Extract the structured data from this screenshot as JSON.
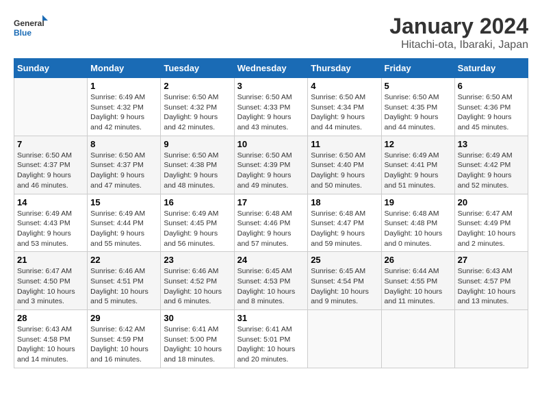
{
  "logo": {
    "text_general": "General",
    "text_blue": "Blue"
  },
  "header": {
    "month": "January 2024",
    "location": "Hitachi-ota, Ibaraki, Japan"
  },
  "weekdays": [
    "Sunday",
    "Monday",
    "Tuesday",
    "Wednesday",
    "Thursday",
    "Friday",
    "Saturday"
  ],
  "weeks": [
    [
      {
        "day": "",
        "sunrise": "",
        "sunset": "",
        "daylight": ""
      },
      {
        "day": "1",
        "sunrise": "Sunrise: 6:49 AM",
        "sunset": "Sunset: 4:32 PM",
        "daylight": "Daylight: 9 hours and 42 minutes."
      },
      {
        "day": "2",
        "sunrise": "Sunrise: 6:50 AM",
        "sunset": "Sunset: 4:32 PM",
        "daylight": "Daylight: 9 hours and 42 minutes."
      },
      {
        "day": "3",
        "sunrise": "Sunrise: 6:50 AM",
        "sunset": "Sunset: 4:33 PM",
        "daylight": "Daylight: 9 hours and 43 minutes."
      },
      {
        "day": "4",
        "sunrise": "Sunrise: 6:50 AM",
        "sunset": "Sunset: 4:34 PM",
        "daylight": "Daylight: 9 hours and 44 minutes."
      },
      {
        "day": "5",
        "sunrise": "Sunrise: 6:50 AM",
        "sunset": "Sunset: 4:35 PM",
        "daylight": "Daylight: 9 hours and 44 minutes."
      },
      {
        "day": "6",
        "sunrise": "Sunrise: 6:50 AM",
        "sunset": "Sunset: 4:36 PM",
        "daylight": "Daylight: 9 hours and 45 minutes."
      }
    ],
    [
      {
        "day": "7",
        "sunrise": "Sunrise: 6:50 AM",
        "sunset": "Sunset: 4:37 PM",
        "daylight": "Daylight: 9 hours and 46 minutes."
      },
      {
        "day": "8",
        "sunrise": "Sunrise: 6:50 AM",
        "sunset": "Sunset: 4:37 PM",
        "daylight": "Daylight: 9 hours and 47 minutes."
      },
      {
        "day": "9",
        "sunrise": "Sunrise: 6:50 AM",
        "sunset": "Sunset: 4:38 PM",
        "daylight": "Daylight: 9 hours and 48 minutes."
      },
      {
        "day": "10",
        "sunrise": "Sunrise: 6:50 AM",
        "sunset": "Sunset: 4:39 PM",
        "daylight": "Daylight: 9 hours and 49 minutes."
      },
      {
        "day": "11",
        "sunrise": "Sunrise: 6:50 AM",
        "sunset": "Sunset: 4:40 PM",
        "daylight": "Daylight: 9 hours and 50 minutes."
      },
      {
        "day": "12",
        "sunrise": "Sunrise: 6:49 AM",
        "sunset": "Sunset: 4:41 PM",
        "daylight": "Daylight: 9 hours and 51 minutes."
      },
      {
        "day": "13",
        "sunrise": "Sunrise: 6:49 AM",
        "sunset": "Sunset: 4:42 PM",
        "daylight": "Daylight: 9 hours and 52 minutes."
      }
    ],
    [
      {
        "day": "14",
        "sunrise": "Sunrise: 6:49 AM",
        "sunset": "Sunset: 4:43 PM",
        "daylight": "Daylight: 9 hours and 53 minutes."
      },
      {
        "day": "15",
        "sunrise": "Sunrise: 6:49 AM",
        "sunset": "Sunset: 4:44 PM",
        "daylight": "Daylight: 9 hours and 55 minutes."
      },
      {
        "day": "16",
        "sunrise": "Sunrise: 6:49 AM",
        "sunset": "Sunset: 4:45 PM",
        "daylight": "Daylight: 9 hours and 56 minutes."
      },
      {
        "day": "17",
        "sunrise": "Sunrise: 6:48 AM",
        "sunset": "Sunset: 4:46 PM",
        "daylight": "Daylight: 9 hours and 57 minutes."
      },
      {
        "day": "18",
        "sunrise": "Sunrise: 6:48 AM",
        "sunset": "Sunset: 4:47 PM",
        "daylight": "Daylight: 9 hours and 59 minutes."
      },
      {
        "day": "19",
        "sunrise": "Sunrise: 6:48 AM",
        "sunset": "Sunset: 4:48 PM",
        "daylight": "Daylight: 10 hours and 0 minutes."
      },
      {
        "day": "20",
        "sunrise": "Sunrise: 6:47 AM",
        "sunset": "Sunset: 4:49 PM",
        "daylight": "Daylight: 10 hours and 2 minutes."
      }
    ],
    [
      {
        "day": "21",
        "sunrise": "Sunrise: 6:47 AM",
        "sunset": "Sunset: 4:50 PM",
        "daylight": "Daylight: 10 hours and 3 minutes."
      },
      {
        "day": "22",
        "sunrise": "Sunrise: 6:46 AM",
        "sunset": "Sunset: 4:51 PM",
        "daylight": "Daylight: 10 hours and 5 minutes."
      },
      {
        "day": "23",
        "sunrise": "Sunrise: 6:46 AM",
        "sunset": "Sunset: 4:52 PM",
        "daylight": "Daylight: 10 hours and 6 minutes."
      },
      {
        "day": "24",
        "sunrise": "Sunrise: 6:45 AM",
        "sunset": "Sunset: 4:53 PM",
        "daylight": "Daylight: 10 hours and 8 minutes."
      },
      {
        "day": "25",
        "sunrise": "Sunrise: 6:45 AM",
        "sunset": "Sunset: 4:54 PM",
        "daylight": "Daylight: 10 hours and 9 minutes."
      },
      {
        "day": "26",
        "sunrise": "Sunrise: 6:44 AM",
        "sunset": "Sunset: 4:55 PM",
        "daylight": "Daylight: 10 hours and 11 minutes."
      },
      {
        "day": "27",
        "sunrise": "Sunrise: 6:43 AM",
        "sunset": "Sunset: 4:57 PM",
        "daylight": "Daylight: 10 hours and 13 minutes."
      }
    ],
    [
      {
        "day": "28",
        "sunrise": "Sunrise: 6:43 AM",
        "sunset": "Sunset: 4:58 PM",
        "daylight": "Daylight: 10 hours and 14 minutes."
      },
      {
        "day": "29",
        "sunrise": "Sunrise: 6:42 AM",
        "sunset": "Sunset: 4:59 PM",
        "daylight": "Daylight: 10 hours and 16 minutes."
      },
      {
        "day": "30",
        "sunrise": "Sunrise: 6:41 AM",
        "sunset": "Sunset: 5:00 PM",
        "daylight": "Daylight: 10 hours and 18 minutes."
      },
      {
        "day": "31",
        "sunrise": "Sunrise: 6:41 AM",
        "sunset": "Sunset: 5:01 PM",
        "daylight": "Daylight: 10 hours and 20 minutes."
      },
      {
        "day": "",
        "sunrise": "",
        "sunset": "",
        "daylight": ""
      },
      {
        "day": "",
        "sunrise": "",
        "sunset": "",
        "daylight": ""
      },
      {
        "day": "",
        "sunrise": "",
        "sunset": "",
        "daylight": ""
      }
    ]
  ]
}
